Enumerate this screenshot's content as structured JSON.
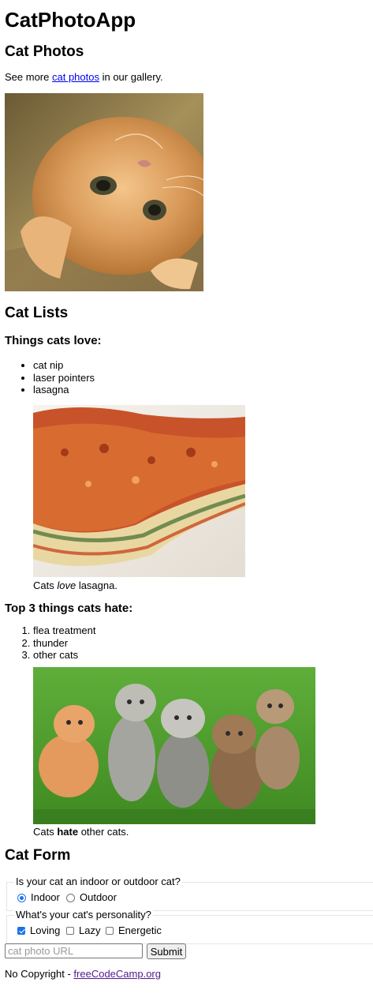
{
  "app_title": "CatPhotoApp",
  "photos_section": {
    "heading": "Cat Photos",
    "intro_before": "See more ",
    "intro_link": "cat photos",
    "intro_after": " in our gallery."
  },
  "lists_section": {
    "heading": "Cat Lists",
    "love_heading": "Things cats love:",
    "love_items": [
      "cat nip",
      "laser pointers",
      "lasagna"
    ],
    "love_caption_before": "Cats ",
    "love_caption_em": "love",
    "love_caption_after": " lasagna.",
    "hate_heading": "Top 3 things cats hate:",
    "hate_items": [
      "flea treatment",
      "thunder",
      "other cats"
    ],
    "hate_caption_before": "Cats ",
    "hate_caption_strong": "hate",
    "hate_caption_after": " other cats."
  },
  "form_section": {
    "heading": "Cat Form",
    "location_legend": "Is your cat an indoor or outdoor cat?",
    "location_options": [
      {
        "label": "Indoor",
        "checked": true
      },
      {
        "label": "Outdoor",
        "checked": false
      }
    ],
    "personality_legend": "What's your cat's personality?",
    "personality_options": [
      {
        "label": "Loving",
        "checked": true
      },
      {
        "label": "Lazy",
        "checked": false
      },
      {
        "label": "Energetic",
        "checked": false
      }
    ],
    "url_placeholder": "cat photo URL",
    "submit_label": "Submit"
  },
  "footer": {
    "prefix": "No Copyright - ",
    "link": "freeCodeCamp.org"
  },
  "images": {
    "kitten": "orange-kitten-photo",
    "lasagna": "lasagna-photo",
    "kittens": "five-kittens-on-grass-photo"
  }
}
